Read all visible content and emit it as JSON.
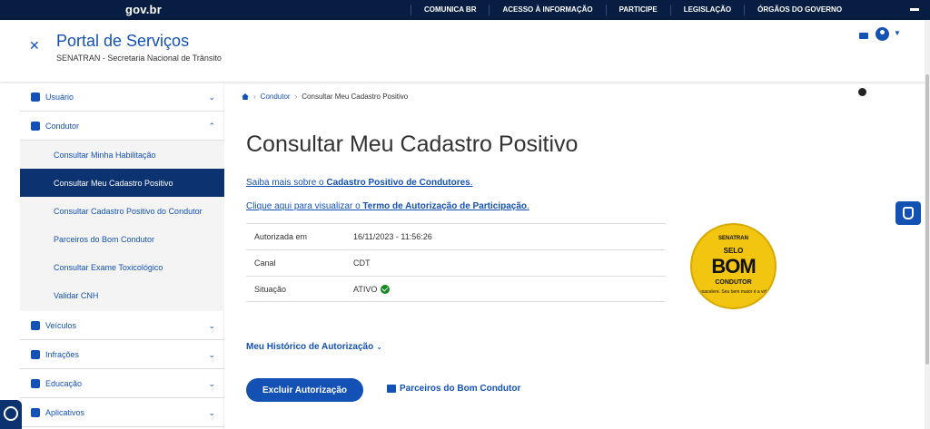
{
  "topbar": {
    "logo": "gov.br",
    "nav": [
      "COMUNICA BR",
      "ACESSO À INFORMAÇÃO",
      "PARTICIPE",
      "LEGISLAÇÃO",
      "ÓRGÃOS DO GOVERNO"
    ]
  },
  "header": {
    "title": "Portal de Serviços",
    "subtitle": "SENATRAN - Secretaria Nacional de Trânsito"
  },
  "sidebar": {
    "items": [
      {
        "label": "Usuário"
      },
      {
        "label": "Condutor"
      },
      {
        "label": "Veículos"
      },
      {
        "label": "Infrações"
      },
      {
        "label": "Educação"
      },
      {
        "label": "Aplicativos"
      }
    ],
    "condutor_sub": [
      "Consultar Minha Habilitação",
      "Consultar Meu Cadastro Positivo",
      "Consultar Cadastro Positivo do Condutor",
      "Parceiros do Bom Condutor",
      "Consultar Exame Toxicológico",
      "Validar CNH"
    ]
  },
  "breadcrumb": {
    "items": [
      "Condutor",
      "Consultar Meu Cadastro Positivo"
    ]
  },
  "main": {
    "title": "Consultar Meu Cadastro Positivo",
    "link1_prefix": "Saiba mais sobre o ",
    "link1_bold": "Cadastro Positivo de Condutores",
    "link1_suffix": ".",
    "link2_prefix": "Clique aqui para visualizar o ",
    "link2_bold": "Termo de Autorização de Participação",
    "link2_suffix": ".",
    "table": [
      {
        "key": "Autorizada em",
        "value": "16/11/2023 - 11:56:26"
      },
      {
        "key": "Canal",
        "value": "CDT"
      },
      {
        "key": "Situação",
        "value": "ATIVO"
      }
    ],
    "historico": "Meu Histórico de Autorização",
    "btn_excluir": "Excluir Autorização",
    "btn_parceiros": "Parceiros do Bom Condutor"
  },
  "selo": {
    "top": "SENATRAN",
    "selo": "SELO",
    "bom": "BOM",
    "condutor": "CONDUTOR",
    "slogan": "Desacelere. Seu bem maior é a vida."
  },
  "colors": {
    "primary": "#1351b4",
    "dark": "#0c326f",
    "topbar": "#071d41",
    "success": "#168821",
    "selo": "#f2c511"
  }
}
